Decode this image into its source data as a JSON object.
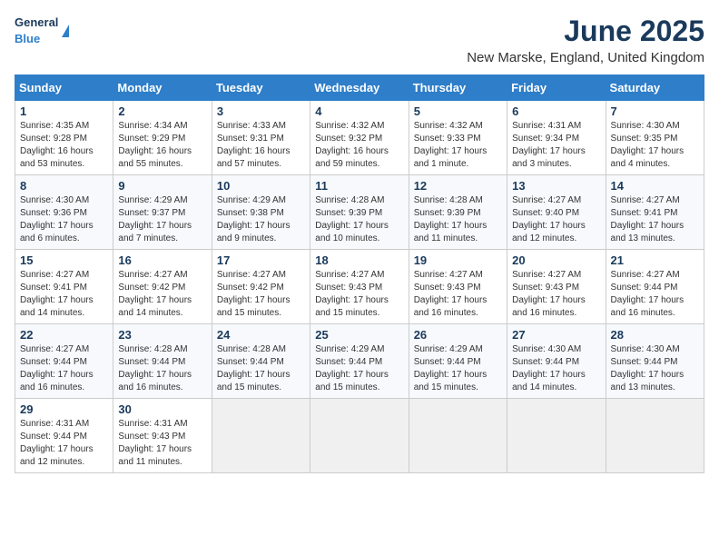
{
  "header": {
    "logo_general": "General",
    "logo_blue": "Blue",
    "month_title": "June 2025",
    "location": "New Marske, England, United Kingdom"
  },
  "days_of_week": [
    "Sunday",
    "Monday",
    "Tuesday",
    "Wednesday",
    "Thursday",
    "Friday",
    "Saturday"
  ],
  "weeks": [
    [
      {
        "day": 1,
        "lines": [
          "Sunrise: 4:35 AM",
          "Sunset: 9:28 PM",
          "Daylight: 16 hours",
          "and 53 minutes."
        ]
      },
      {
        "day": 2,
        "lines": [
          "Sunrise: 4:34 AM",
          "Sunset: 9:29 PM",
          "Daylight: 16 hours",
          "and 55 minutes."
        ]
      },
      {
        "day": 3,
        "lines": [
          "Sunrise: 4:33 AM",
          "Sunset: 9:31 PM",
          "Daylight: 16 hours",
          "and 57 minutes."
        ]
      },
      {
        "day": 4,
        "lines": [
          "Sunrise: 4:32 AM",
          "Sunset: 9:32 PM",
          "Daylight: 16 hours",
          "and 59 minutes."
        ]
      },
      {
        "day": 5,
        "lines": [
          "Sunrise: 4:32 AM",
          "Sunset: 9:33 PM",
          "Daylight: 17 hours",
          "and 1 minute."
        ]
      },
      {
        "day": 6,
        "lines": [
          "Sunrise: 4:31 AM",
          "Sunset: 9:34 PM",
          "Daylight: 17 hours",
          "and 3 minutes."
        ]
      },
      {
        "day": 7,
        "lines": [
          "Sunrise: 4:30 AM",
          "Sunset: 9:35 PM",
          "Daylight: 17 hours",
          "and 4 minutes."
        ]
      }
    ],
    [
      {
        "day": 8,
        "lines": [
          "Sunrise: 4:30 AM",
          "Sunset: 9:36 PM",
          "Daylight: 17 hours",
          "and 6 minutes."
        ]
      },
      {
        "day": 9,
        "lines": [
          "Sunrise: 4:29 AM",
          "Sunset: 9:37 PM",
          "Daylight: 17 hours",
          "and 7 minutes."
        ]
      },
      {
        "day": 10,
        "lines": [
          "Sunrise: 4:29 AM",
          "Sunset: 9:38 PM",
          "Daylight: 17 hours",
          "and 9 minutes."
        ]
      },
      {
        "day": 11,
        "lines": [
          "Sunrise: 4:28 AM",
          "Sunset: 9:39 PM",
          "Daylight: 17 hours",
          "and 10 minutes."
        ]
      },
      {
        "day": 12,
        "lines": [
          "Sunrise: 4:28 AM",
          "Sunset: 9:39 PM",
          "Daylight: 17 hours",
          "and 11 minutes."
        ]
      },
      {
        "day": 13,
        "lines": [
          "Sunrise: 4:27 AM",
          "Sunset: 9:40 PM",
          "Daylight: 17 hours",
          "and 12 minutes."
        ]
      },
      {
        "day": 14,
        "lines": [
          "Sunrise: 4:27 AM",
          "Sunset: 9:41 PM",
          "Daylight: 17 hours",
          "and 13 minutes."
        ]
      }
    ],
    [
      {
        "day": 15,
        "lines": [
          "Sunrise: 4:27 AM",
          "Sunset: 9:41 PM",
          "Daylight: 17 hours",
          "and 14 minutes."
        ]
      },
      {
        "day": 16,
        "lines": [
          "Sunrise: 4:27 AM",
          "Sunset: 9:42 PM",
          "Daylight: 17 hours",
          "and 14 minutes."
        ]
      },
      {
        "day": 17,
        "lines": [
          "Sunrise: 4:27 AM",
          "Sunset: 9:42 PM",
          "Daylight: 17 hours",
          "and 15 minutes."
        ]
      },
      {
        "day": 18,
        "lines": [
          "Sunrise: 4:27 AM",
          "Sunset: 9:43 PM",
          "Daylight: 17 hours",
          "and 15 minutes."
        ]
      },
      {
        "day": 19,
        "lines": [
          "Sunrise: 4:27 AM",
          "Sunset: 9:43 PM",
          "Daylight: 17 hours",
          "and 16 minutes."
        ]
      },
      {
        "day": 20,
        "lines": [
          "Sunrise: 4:27 AM",
          "Sunset: 9:43 PM",
          "Daylight: 17 hours",
          "and 16 minutes."
        ]
      },
      {
        "day": 21,
        "lines": [
          "Sunrise: 4:27 AM",
          "Sunset: 9:44 PM",
          "Daylight: 17 hours",
          "and 16 minutes."
        ]
      }
    ],
    [
      {
        "day": 22,
        "lines": [
          "Sunrise: 4:27 AM",
          "Sunset: 9:44 PM",
          "Daylight: 17 hours",
          "and 16 minutes."
        ]
      },
      {
        "day": 23,
        "lines": [
          "Sunrise: 4:28 AM",
          "Sunset: 9:44 PM",
          "Daylight: 17 hours",
          "and 16 minutes."
        ]
      },
      {
        "day": 24,
        "lines": [
          "Sunrise: 4:28 AM",
          "Sunset: 9:44 PM",
          "Daylight: 17 hours",
          "and 15 minutes."
        ]
      },
      {
        "day": 25,
        "lines": [
          "Sunrise: 4:29 AM",
          "Sunset: 9:44 PM",
          "Daylight: 17 hours",
          "and 15 minutes."
        ]
      },
      {
        "day": 26,
        "lines": [
          "Sunrise: 4:29 AM",
          "Sunset: 9:44 PM",
          "Daylight: 17 hours",
          "and 15 minutes."
        ]
      },
      {
        "day": 27,
        "lines": [
          "Sunrise: 4:30 AM",
          "Sunset: 9:44 PM",
          "Daylight: 17 hours",
          "and 14 minutes."
        ]
      },
      {
        "day": 28,
        "lines": [
          "Sunrise: 4:30 AM",
          "Sunset: 9:44 PM",
          "Daylight: 17 hours",
          "and 13 minutes."
        ]
      }
    ],
    [
      {
        "day": 29,
        "lines": [
          "Sunrise: 4:31 AM",
          "Sunset: 9:44 PM",
          "Daylight: 17 hours",
          "and 12 minutes."
        ]
      },
      {
        "day": 30,
        "lines": [
          "Sunrise: 4:31 AM",
          "Sunset: 9:43 PM",
          "Daylight: 17 hours",
          "and 11 minutes."
        ]
      },
      null,
      null,
      null,
      null,
      null
    ]
  ]
}
